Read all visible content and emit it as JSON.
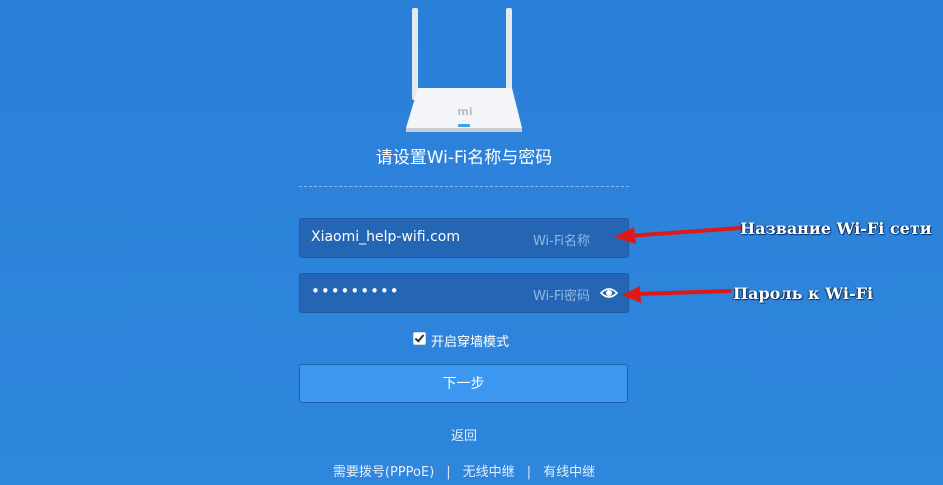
{
  "router": {
    "logo": "mi"
  },
  "setup": {
    "title": "请设置Wi-Fi名称与密码",
    "ssid": {
      "value": "Xiaomi_help-wifi.com",
      "hint": "Wi-Fi名称"
    },
    "password": {
      "masked_value": "•••••••••",
      "hint": "Wi-Fi密码",
      "toggle_icon": "eye-icon"
    },
    "wall_mode": {
      "checked": true,
      "label": "开启穿墙模式"
    },
    "next_label": "下一步",
    "back_label": "返回",
    "links": [
      "需要拨号(PPPoE)",
      "无线中继",
      "有线中继"
    ],
    "link_separator": "|"
  },
  "annotations": {
    "ssid_note": "Название Wi-Fi сети",
    "password_note": "Пароль к Wi-Fi"
  },
  "colors": {
    "background": "#2b7fd6",
    "field_bg": "#2566b4",
    "button_bg": "#3b97ef",
    "arrow": "#e01818"
  }
}
